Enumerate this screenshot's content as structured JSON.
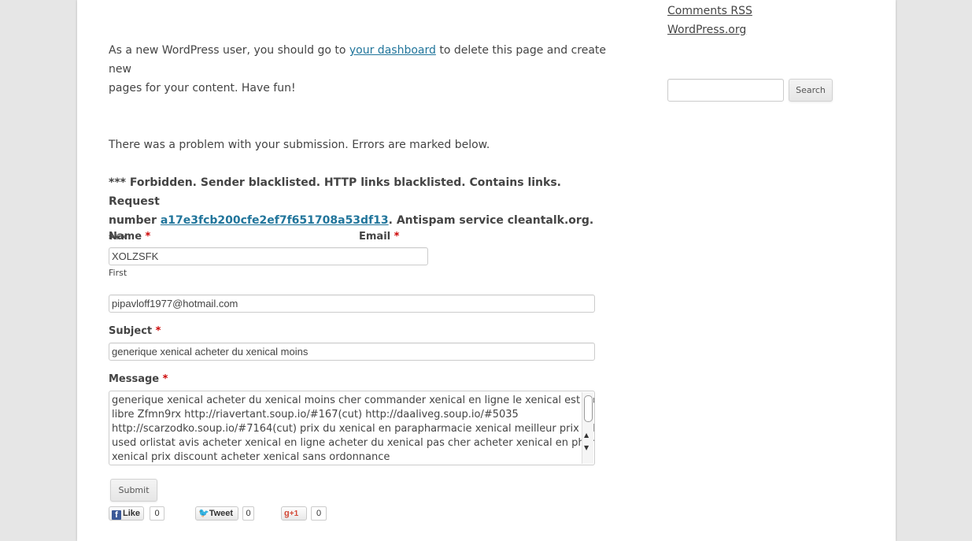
{
  "sidebar": {
    "links": [
      "Comments RSS",
      "WordPress.org"
    ],
    "search_button": "Search",
    "search_value": ""
  },
  "content": {
    "intro_before": "As a new WordPress user, you should go to ",
    "intro_link": "your dashboard",
    "intro_after_line1": " to delete this page and create new",
    "intro_line2": "pages for your content. Have fun!",
    "error_intro": "There was a problem with your submission. Errors are marked below.",
    "error_line1": "*** Forbidden. Sender blacklisted. HTTP links blacklisted. Contains links. Request",
    "error_line2_prefix": "number ",
    "error_request_link": "a17e3fcb200cfe2ef7f651708a53df13",
    "error_line2_suffix": ". Antispam service cleantalk.org. ***"
  },
  "form": {
    "name_label": "Name",
    "email_label": "Email",
    "required_mark": "*",
    "name_value": "XOLZSFK",
    "name_sublabel": "First",
    "email_value": "pipavloff1977@hotmail.com",
    "subject_label": "Subject",
    "subject_value": "generique xenical acheter du xenical moins",
    "message_label": "Message",
    "message_lines": [
      "generique xenical acheter du xenical moins cher commander xenical en ligne le xenical est il en vente",
      "libre Zfmn9rx http://riavertant.soup.io/#167(cut) http://daaliveg.soup.io/#5035",
      "http://scarzodko.soup.io/#7164(cut) prix du xenical en parapharmacie xenical meilleur prix orlistat",
      "used orlistat avis acheter xenical en ligne acheter du xenical pas cher acheter xenical en pharmacie",
      "xenical prix discount acheter xenical sans ordonnance"
    ],
    "submit_label": "Submit"
  },
  "share": {
    "like_label": "Like",
    "like_count": "0",
    "tweet_label": "Tweet",
    "tweet_count": "0",
    "plusone_label": "+1",
    "plusone_count": "0"
  }
}
